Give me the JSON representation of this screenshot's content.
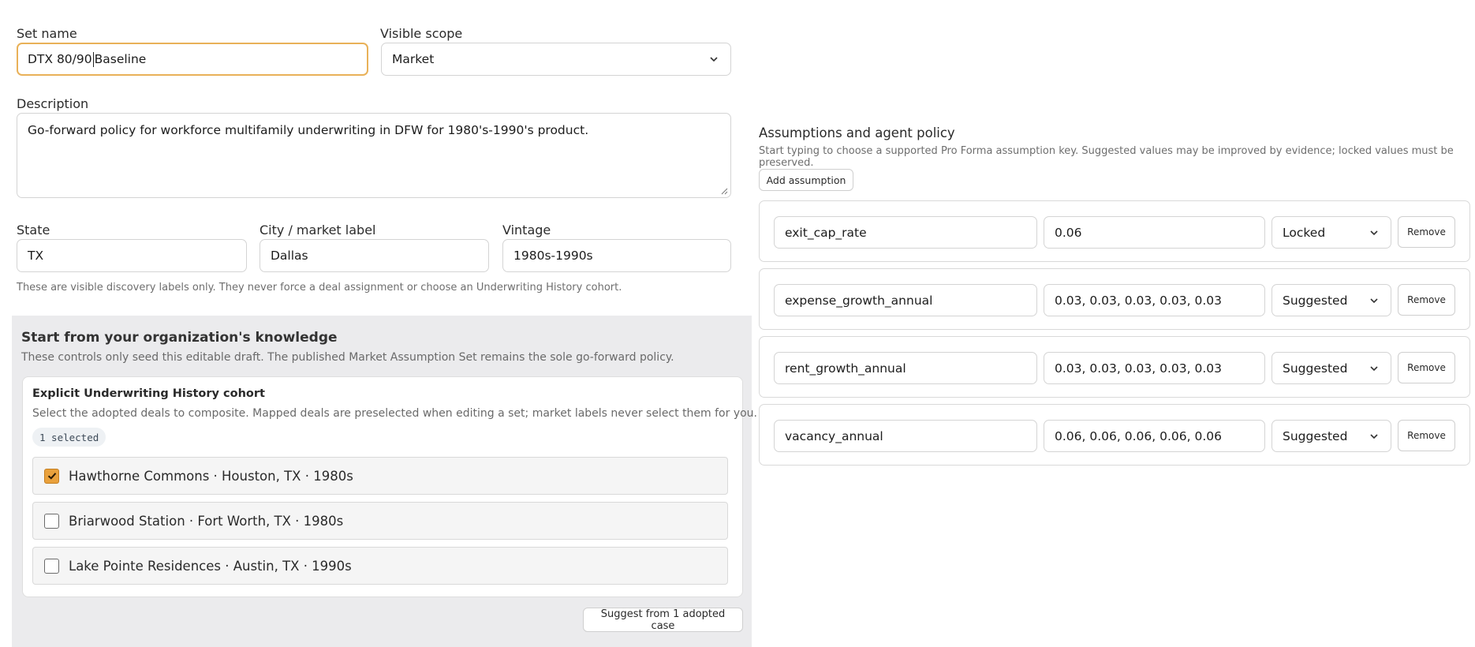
{
  "form": {
    "set_name": {
      "label": "Set name",
      "value_before_caret": "DTX 80/90",
      "value_after_caret": "Baseline"
    },
    "visible_scope": {
      "label": "Visible scope",
      "value": "Market"
    },
    "description": {
      "label": "Description",
      "value": "Go-forward policy for workforce multifamily underwriting in DFW for 1980's-1990's product."
    },
    "state": {
      "label": "State",
      "value": "TX"
    },
    "city": {
      "label": "City / market label",
      "value": "Dallas"
    },
    "vintage": {
      "label": "Vintage",
      "value": "1980s-1990s"
    },
    "labels_hint": "These are visible discovery labels only. They never force a deal assignment or choose an Underwriting History cohort."
  },
  "knowledge": {
    "title": "Start from your organization's knowledge",
    "subtitle": "These controls only seed this editable draft. The published Market Assumption Set remains the sole go-forward policy.",
    "cohort": {
      "title": "Explicit Underwriting History cohort",
      "description": "Select the adopted deals to composite. Mapped deals are preselected when editing a set; market labels never select them for you.",
      "selected_badge": "1 selected",
      "deals": [
        {
          "label": "Hawthorne Commons · Houston, TX · 1980s",
          "checked": true
        },
        {
          "label": "Briarwood Station · Fort Worth, TX · 1980s",
          "checked": false
        },
        {
          "label": "Lake Pointe Residences · Austin, TX · 1990s",
          "checked": false
        }
      ]
    },
    "suggest_button": "Suggest from 1 adopted case"
  },
  "assumptions": {
    "title": "Assumptions and agent policy",
    "hint": "Start typing to choose a supported Pro Forma assumption key. Suggested values may be improved by evidence; locked values must be preserved.",
    "add_button": "Add assumption",
    "remove_label": "Remove",
    "rows": [
      {
        "key": "exit_cap_rate",
        "value": "0.06",
        "policy": "Locked"
      },
      {
        "key": "expense_growth_annual",
        "value": "0.03, 0.03, 0.03, 0.03, 0.03",
        "policy": "Suggested"
      },
      {
        "key": "rent_growth_annual",
        "value": "0.03, 0.03, 0.03, 0.03, 0.03",
        "policy": "Suggested"
      },
      {
        "key": "vacancy_annual",
        "value": "0.06, 0.06, 0.06, 0.06, 0.06",
        "policy": "Suggested"
      }
    ]
  },
  "colors": {
    "focus_border": "#e9b158",
    "checkbox_checked": "#e9a13c",
    "panel_gray": "#ebebed"
  }
}
